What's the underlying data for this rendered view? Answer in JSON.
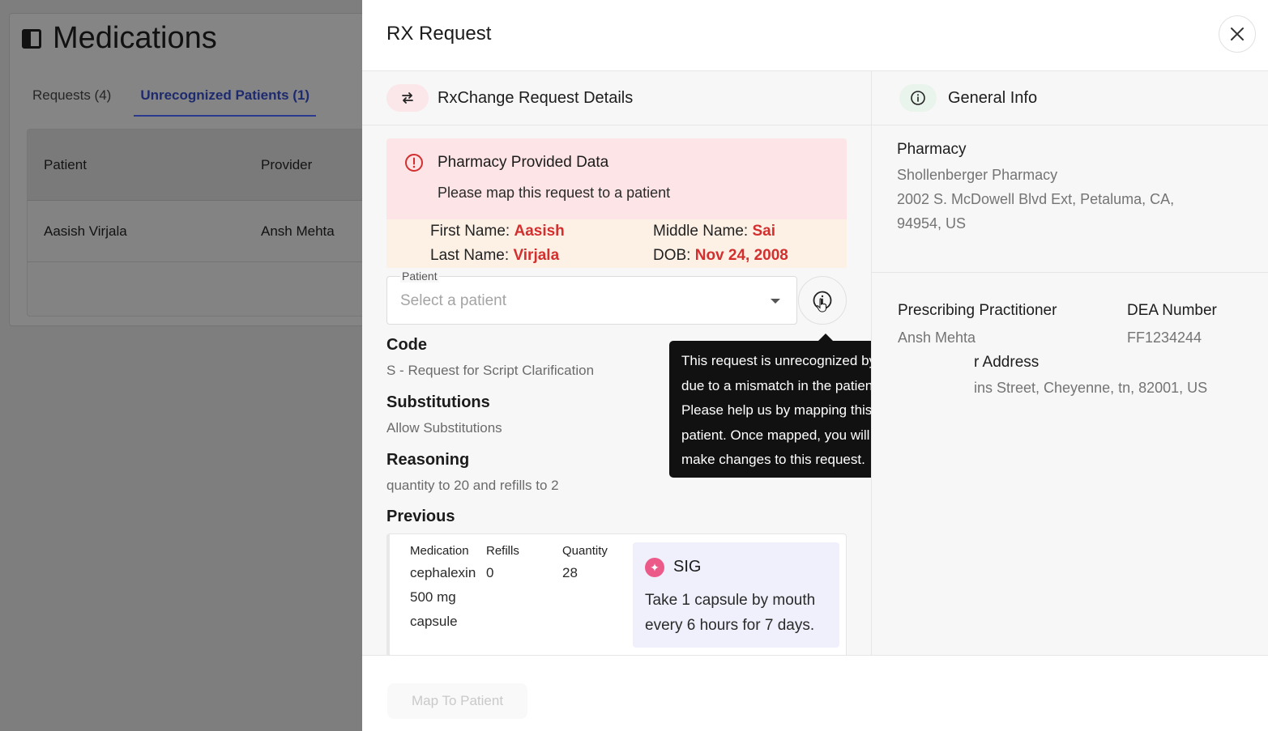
{
  "background": {
    "title": "Medications",
    "tabs": [
      {
        "label": "Requests (4)",
        "active": false
      },
      {
        "label": "Unrecognized Patients (1)",
        "active": true
      }
    ],
    "table": {
      "headers": [
        "Patient",
        "Provider"
      ],
      "rows": [
        [
          "Aasish Virjala",
          "Ansh Mehta"
        ]
      ]
    }
  },
  "modal": {
    "title": "RX Request",
    "close_icon": "close-icon",
    "left": {
      "section_title": "RxChange Request Details",
      "section_icon": "swap-arrows-icon",
      "alert": {
        "title": "Pharmacy Provided Data",
        "message": "Please map this request to a patient",
        "icon": "alert-circle-icon"
      },
      "pharmacy_data": {
        "first_name_label": "First Name:",
        "first_name": "Aasish",
        "middle_name_label": "Middle Name:",
        "middle_name": "Sai",
        "last_name_label": "Last Name:",
        "last_name": "Virjala",
        "dob_label": "DOB:",
        "dob": "Nov 24, 2008"
      },
      "patient_select": {
        "label": "Patient",
        "placeholder": "Select a patient"
      },
      "code": {
        "label": "Code",
        "value": "S - Request for Script Clarification"
      },
      "substitutions": {
        "label": "Substitutions",
        "value": "Allow Substitutions"
      },
      "reasoning": {
        "label": "Reasoning",
        "value": "quantity to 20 and refills to 2"
      },
      "previous": {
        "label": "Previous",
        "columns": [
          "Medication",
          "Refills",
          "Quantity"
        ],
        "medication_lines": [
          "cephalexin",
          "500 mg",
          "capsule"
        ],
        "refills": "0",
        "quantity": "28",
        "sig": {
          "title": "SIG",
          "text": "Take 1 capsule by mouth every 6 hours for 7 days."
        }
      },
      "tooltip": "This request is unrecognized by this system due to a mismatch in the patient information. Please help us by mapping this request to a patient. Once mapped, you will be able to make changes to this request."
    },
    "right": {
      "section_title": "General Info",
      "section_icon": "info-icon",
      "pharmacy": {
        "label": "Pharmacy",
        "name": "Shollenberger Pharmacy",
        "address_line1": "2002 S. McDowell Blvd Ext, Petaluma, CA,",
        "address_line2": "94954, US"
      },
      "practitioner": {
        "label": "Prescribing Practitioner",
        "name_partial": "Ansh Mehta",
        "dea_label": "DEA Number",
        "dea_value": "FF1234244",
        "address_label_partial": "r Address",
        "address_value_partial": "ins Street, Cheyenne, tn, 82001, US"
      }
    },
    "footer": {
      "map_button": "Map To Patient"
    }
  },
  "colors": {
    "accent_blue": "#2a3a8f",
    "alert_bg": "#fde4e6",
    "data_bg": "#fdf1e6",
    "value_red": "#d32f2f",
    "sig_bg": "#eff0fb",
    "sig_icon": "#ec5a8a"
  }
}
